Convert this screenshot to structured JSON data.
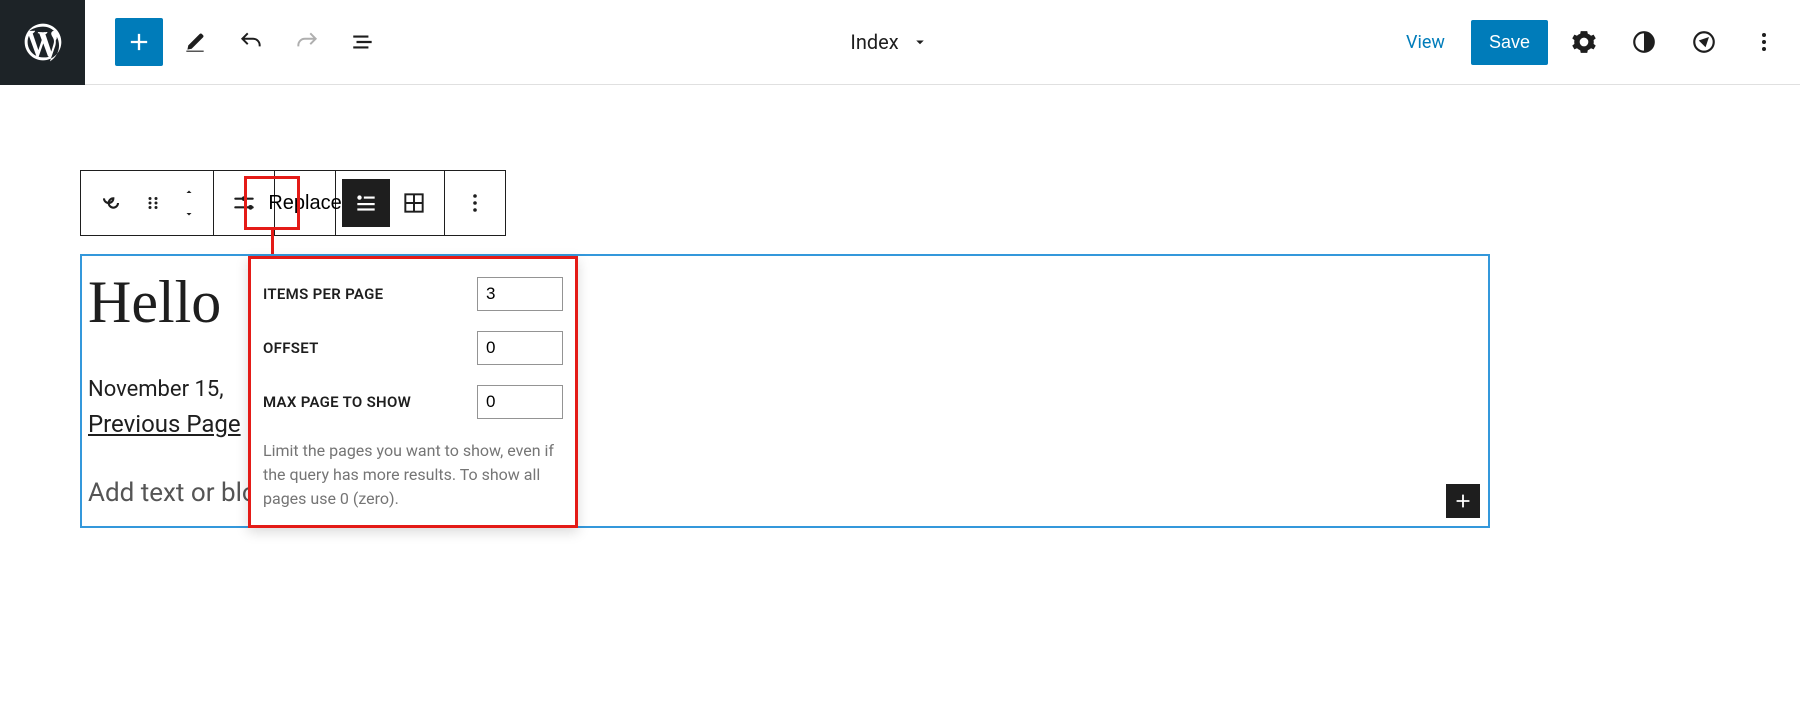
{
  "header": {
    "document_title": "Index",
    "view_label": "View",
    "save_label": "Save"
  },
  "block_toolbar": {
    "replace_label": "Replace"
  },
  "popover": {
    "items_per_page_label": "ITEMS PER PAGE",
    "items_per_page_value": "3",
    "offset_label": "OFFSET",
    "offset_value": "0",
    "max_page_label": "MAX PAGE TO SHOW",
    "max_page_value": "0",
    "help_text": "Limit the pages you want to show, even if the query has more results. To show all pages use 0 (zero)."
  },
  "canvas": {
    "post_title": "Hello",
    "post_date": "November 15,",
    "previous_page_label": "Previous Page",
    "no_results_text": "Add text or blo                                                    query returns no results."
  }
}
